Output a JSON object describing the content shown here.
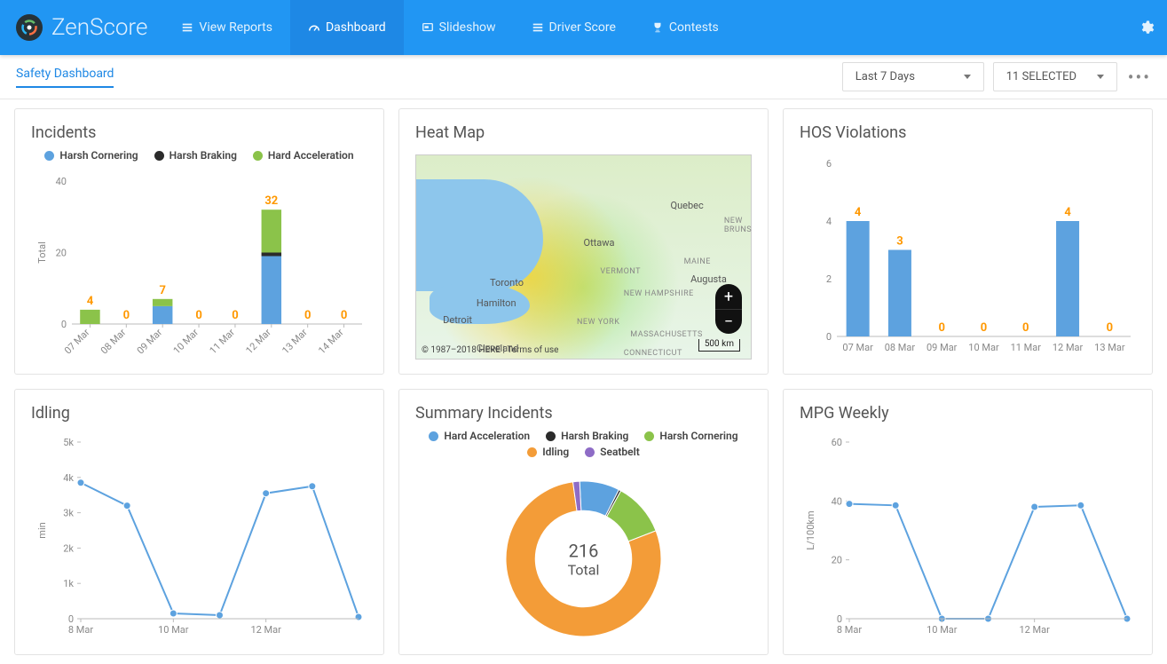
{
  "brand": {
    "name": "ZenScore"
  },
  "nav": {
    "items": [
      {
        "label": "View Reports",
        "icon": "list-icon"
      },
      {
        "label": "Dashboard",
        "icon": "gauge-icon",
        "active": true
      },
      {
        "label": "Slideshow",
        "icon": "slides-icon"
      },
      {
        "label": "Driver Score",
        "icon": "list-icon"
      },
      {
        "label": "Contests",
        "icon": "trophy-icon"
      }
    ]
  },
  "subbar": {
    "tab": "Safety Dashboard",
    "range": "Last 7 Days",
    "selected": "11 SELECTED"
  },
  "cards": {
    "incidents": {
      "title": "Incidents",
      "ylabel": "Total"
    },
    "heatmap": {
      "title": "Heat Map",
      "labels": [
        "Toronto",
        "Hamilton",
        "Detroit",
        "Cleveland",
        "Ottawa",
        "Quebec",
        "NEW YORK",
        "VERMONT",
        "MAINE",
        "NEW BRUNS",
        "CONNECTICUT",
        "MASSACHUSETTS",
        "NEW HAMPSHIRE",
        "Augusta"
      ],
      "scale": "500 km",
      "attribution": "© 1987–2018 HERE | Terms of use"
    },
    "hos": {
      "title": "HOS Violations"
    },
    "idling": {
      "title": "Idling",
      "ylabel": "min"
    },
    "summary": {
      "title": "Summary Incidents",
      "center_value": "216",
      "center_label": "Total"
    },
    "mpg": {
      "title": "MPG Weekly",
      "ylabel": "L/100km"
    }
  },
  "colors": {
    "blue": "#5da2df",
    "green": "#8bc34a",
    "black": "#2b2b2b",
    "orange": "#f39c38",
    "purple": "#8e6cc6"
  },
  "chart_data": [
    {
      "id": "incidents",
      "type": "bar",
      "stacked": true,
      "ylabel": "Total",
      "ylim": [
        0,
        40
      ],
      "yticks": [
        0,
        20,
        40
      ],
      "categories": [
        "07 Mar",
        "08 Mar",
        "09 Mar",
        "10 Mar",
        "11 Mar",
        "12 Mar",
        "13 Mar",
        "14 Mar"
      ],
      "series": [
        {
          "name": "Harsh Cornering",
          "color": "#5da2df",
          "values": [
            0,
            0,
            5,
            0,
            0,
            19,
            0,
            0
          ]
        },
        {
          "name": "Harsh Braking",
          "color": "#2b2b2b",
          "values": [
            0,
            0,
            0,
            0,
            0,
            1,
            0,
            0
          ]
        },
        {
          "name": "Hard Acceleration",
          "color": "#8bc34a",
          "values": [
            4,
            0,
            2,
            0,
            0,
            12,
            0,
            0
          ]
        }
      ],
      "bar_labels": [
        4,
        0,
        7,
        0,
        0,
        32,
        0,
        0
      ]
    },
    {
      "id": "hos",
      "type": "bar",
      "ylim": [
        0,
        6
      ],
      "yticks": [
        0,
        2,
        4,
        6
      ],
      "categories": [
        "07 Mar",
        "08 Mar",
        "09 Mar",
        "10 Mar",
        "11 Mar",
        "12 Mar",
        "13 Mar"
      ],
      "series": [
        {
          "name": "HOS Violations",
          "color": "#5da2df",
          "values": [
            4,
            3,
            0,
            0,
            0,
            4,
            0
          ]
        }
      ],
      "bar_labels": [
        4,
        3,
        0,
        0,
        0,
        4,
        0
      ]
    },
    {
      "id": "idling",
      "type": "line",
      "ylabel": "min",
      "ylim": [
        0,
        5000
      ],
      "yticks_display": [
        "0",
        "1k",
        "2k",
        "3k",
        "4k",
        "5k"
      ],
      "x": [
        "8 Mar",
        "9 Mar",
        "10 Mar",
        "11 Mar",
        "12 Mar",
        "13 Mar",
        "14 Mar"
      ],
      "x_ticks_display": [
        "8 Mar",
        "10 Mar",
        "12 Mar"
      ],
      "series": [
        {
          "name": "Idling",
          "color": "#5da2df",
          "values": [
            3850,
            3200,
            150,
            100,
            3550,
            3750,
            50
          ]
        }
      ]
    },
    {
      "id": "summary",
      "type": "pie",
      "title": "Summary Incidents",
      "total": 216,
      "series": [
        {
          "name": "Hard Acceleration",
          "color": "#5da2df",
          "value": 18
        },
        {
          "name": "Harsh Braking",
          "color": "#2b2b2b",
          "value": 1
        },
        {
          "name": "Harsh Cornering",
          "color": "#8bc34a",
          "value": 24
        },
        {
          "name": "Idling",
          "color": "#f39c38",
          "value": 170
        },
        {
          "name": "Seatbelt",
          "color": "#8e6cc6",
          "value": 3
        }
      ]
    },
    {
      "id": "mpg",
      "type": "line",
      "ylabel": "L/100km",
      "ylim": [
        0,
        60
      ],
      "yticks": [
        0,
        20,
        40,
        60
      ],
      "x": [
        "8 Mar",
        "9 Mar",
        "10 Mar",
        "11 Mar",
        "12 Mar",
        "13 Mar",
        "14 Mar"
      ],
      "x_ticks_display": [
        "8 Mar",
        "10 Mar",
        "12 Mar"
      ],
      "series": [
        {
          "name": "MPG",
          "color": "#5da2df",
          "values": [
            39,
            38.5,
            0,
            0,
            38,
            38.5,
            0
          ]
        }
      ]
    }
  ]
}
